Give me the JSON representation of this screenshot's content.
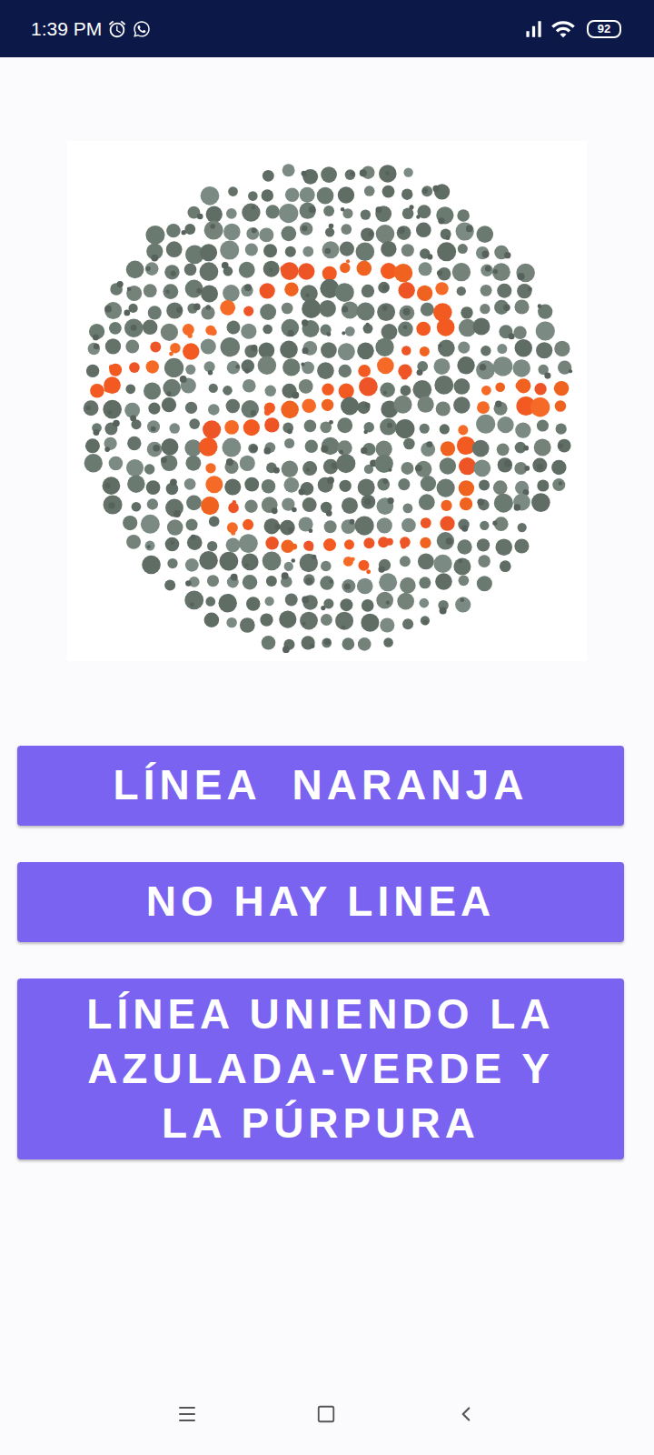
{
  "status_bar": {
    "time": "1:39 PM",
    "battery": "92"
  },
  "buttons": [
    "LÍNEA  NARANJA",
    "NO HAY LINEA",
    "LÍNEA UNIENDO LA AZULADA-VERDE Y LA PÚRPURA"
  ]
}
